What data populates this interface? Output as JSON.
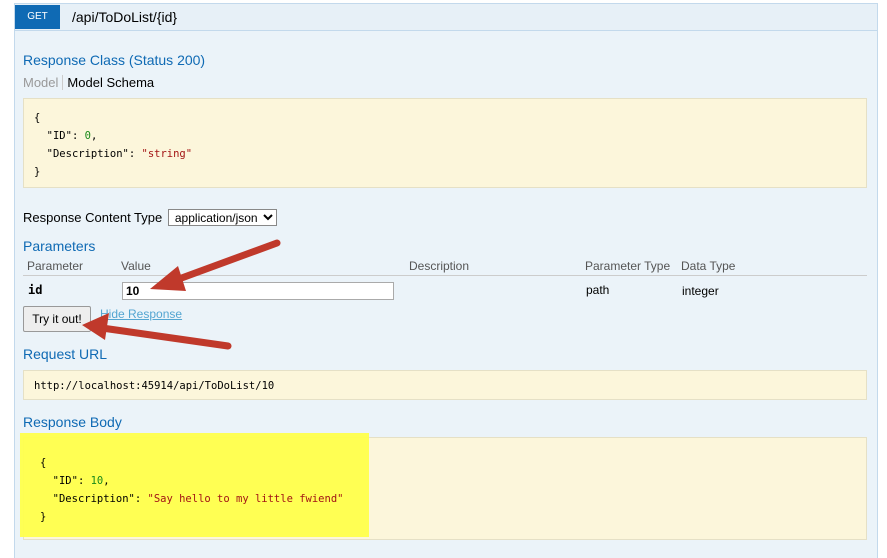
{
  "operation": {
    "method": "GET",
    "path": "/api/ToDoList/{id}"
  },
  "response_class": {
    "title": "Response Class (Status 200)",
    "tab_model": "Model",
    "tab_schema": "Model Schema",
    "schema": {
      "open": "{",
      "id_key": "\"ID\"",
      "id_value": "0",
      "desc_key": "\"Description\"",
      "desc_value": "\"string\"",
      "close": "}"
    }
  },
  "content_type": {
    "label": "Response Content Type",
    "selected": "application/json"
  },
  "parameters": {
    "title": "Parameters",
    "columns": [
      "Parameter",
      "Value",
      "Description",
      "Parameter Type",
      "Data Type"
    ],
    "row": {
      "name": "id",
      "value": "10",
      "description": "",
      "param_type": "path",
      "data_type": "integer"
    }
  },
  "actions": {
    "try_label": "Try it out!",
    "hide_label": "Hide Response"
  },
  "request_url": {
    "title": "Request URL",
    "url": "http://localhost:45914/api/ToDoList/10"
  },
  "response_body": {
    "title": "Response Body",
    "open": "{",
    "id_key": "\"ID\"",
    "id_value": "10",
    "desc_key": "\"Description\"",
    "desc_value": "\"Say hello to my little fwiend\"",
    "close": "}"
  },
  "colors": {
    "accent": "#0f6ab4",
    "arrow": "#c0392b",
    "highlight": "#ffff4c"
  }
}
